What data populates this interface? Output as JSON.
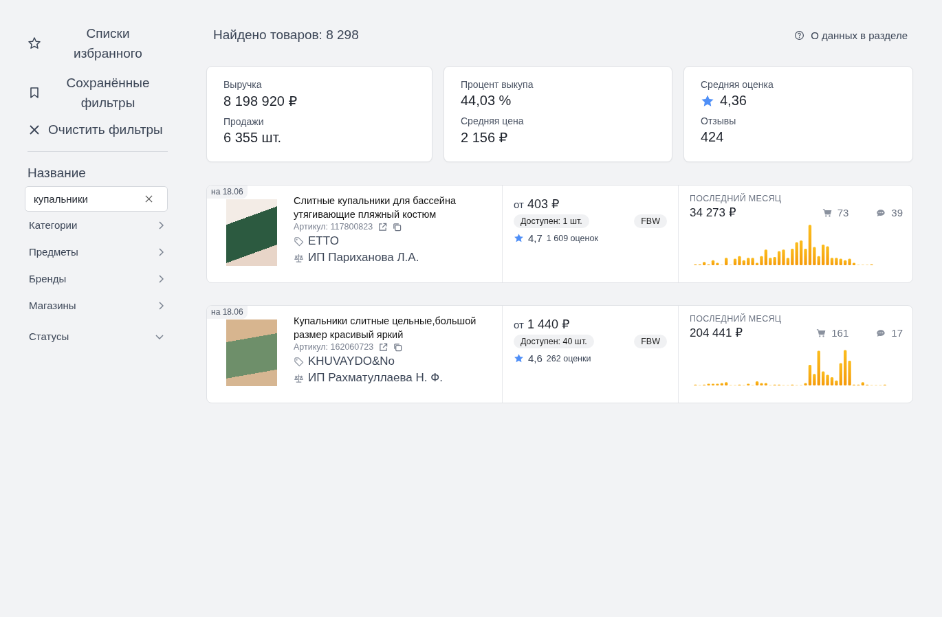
{
  "sidebar": {
    "actions": [
      {
        "kind": "star",
        "label": "Списки избранного"
      },
      {
        "kind": "bookmark",
        "label": "Сохранённые фильтры"
      },
      {
        "kind": "clear",
        "label": "Очистить фильтры"
      }
    ],
    "name_filter": {
      "title": "Название",
      "value": "купальники"
    },
    "filters": [
      {
        "label": "Категории",
        "kind": "submenu"
      },
      {
        "label": "Предметы",
        "kind": "submenu"
      },
      {
        "label": "Бренды",
        "kind": "submenu"
      },
      {
        "label": "Магазины",
        "kind": "submenu"
      },
      {
        "label": "Статусы",
        "kind": "dropdown"
      }
    ]
  },
  "header": {
    "found": "Найдено товаров: 8 298",
    "about_link": "О данных в разделе"
  },
  "summary_cards": [
    {
      "metrics": [
        {
          "label": "Выручка",
          "value": "8 198 920 ₽",
          "kind": "plain"
        },
        {
          "label": "Продажи",
          "value": "6 355 шт.",
          "kind": "plain"
        }
      ]
    },
    {
      "metrics": [
        {
          "label": "Процент выкупа",
          "value": "44,03 %",
          "kind": "plain"
        },
        {
          "label": "Средняя цена",
          "value": "2 156 ₽",
          "kind": "plain"
        }
      ]
    },
    {
      "metrics": [
        {
          "label": "Средняя оценка",
          "value": "4,36",
          "kind": "rating"
        },
        {
          "label": "Отзывы",
          "value": "424",
          "kind": "plain"
        }
      ]
    }
  ],
  "products": [
    {
      "date": "на 18.06",
      "title": "Слитные купальники для бассейна утягивающие пляжный костюм",
      "article": "Артикул: 117800823",
      "brand": "ETTO",
      "seller": "ИП Париханова Л.А.",
      "price_prefix": "от",
      "price": "403 ₽",
      "stock": "Доступен: 1 шт.",
      "fulfillment": "FBW",
      "rating": "4,7",
      "ratings_count": "1 609 оценок",
      "period": "ПОСЛЕДНИЙ МЕСЯЦ",
      "revenue": "34 273 ₽",
      "orders": "73",
      "reviews": "39"
    },
    {
      "date": "на 18.06",
      "title": "Купальники слитные цельные,большой размер красивый яркий",
      "article": "Артикул: 162060723",
      "brand": "KHUVAYDO&No",
      "seller": "ИП Рахматуллаева Н. Ф.",
      "price_prefix": "от",
      "price": "1 440 ₽",
      "stock": "Доступен: 40 шт.",
      "fulfillment": "FBW",
      "rating": "4,6",
      "ratings_count": "262 оценки",
      "period": "ПОСЛЕДНИЙ МЕСЯЦ",
      "revenue": "204 441 ₽",
      "orders": "161",
      "reviews": "17"
    }
  ]
}
